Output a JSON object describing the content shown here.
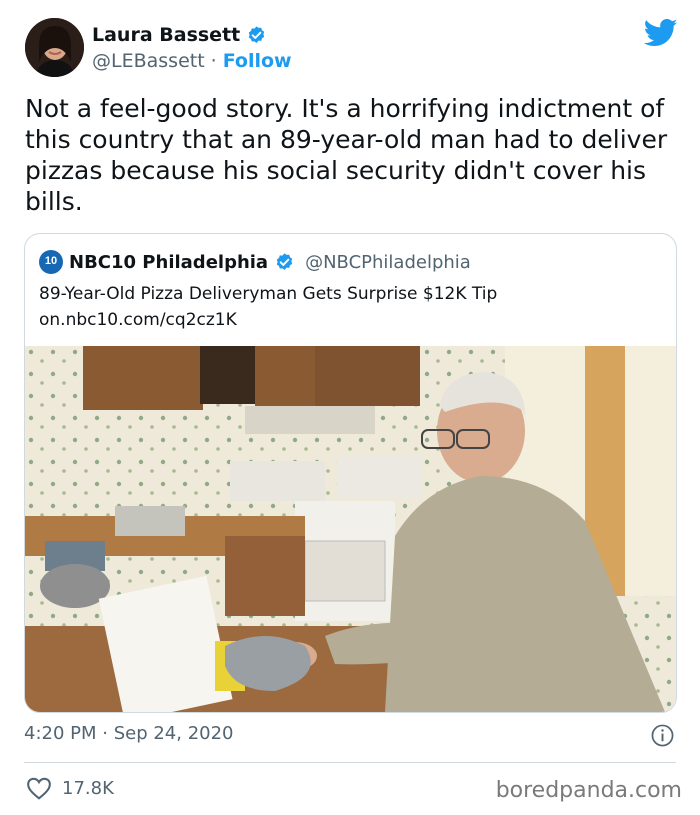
{
  "author": {
    "name": "Laura Bassett",
    "handle": "@LEBassett",
    "separator": "·",
    "follow_label": "Follow"
  },
  "tweet_text": "Not a feel-good story. It's a horrifying indictment of this country that an 89-year-old man had to deliver pizzas because his social security didn't cover his bills.",
  "quoted": {
    "logo_text": "10",
    "name": "NBC10 Philadelphia",
    "handle": "@NBCPhiladelphia",
    "headline": "89-Year-Old Pizza Deliveryman Gets Surprise $12K Tip",
    "link": "on.nbc10.com/cq2cz1K"
  },
  "timestamp": "4:20 PM · Sep 24, 2020",
  "likes": "17.8K",
  "watermark": "boredpanda.com",
  "colors": {
    "accent": "#1d9bf0",
    "text": "#0f1419",
    "secondary": "#536471",
    "border": "#cfd9de"
  },
  "icons": [
    "avatar-photo",
    "verified-badge-icon",
    "twitter-bird-icon",
    "info-icon",
    "heart-icon"
  ]
}
